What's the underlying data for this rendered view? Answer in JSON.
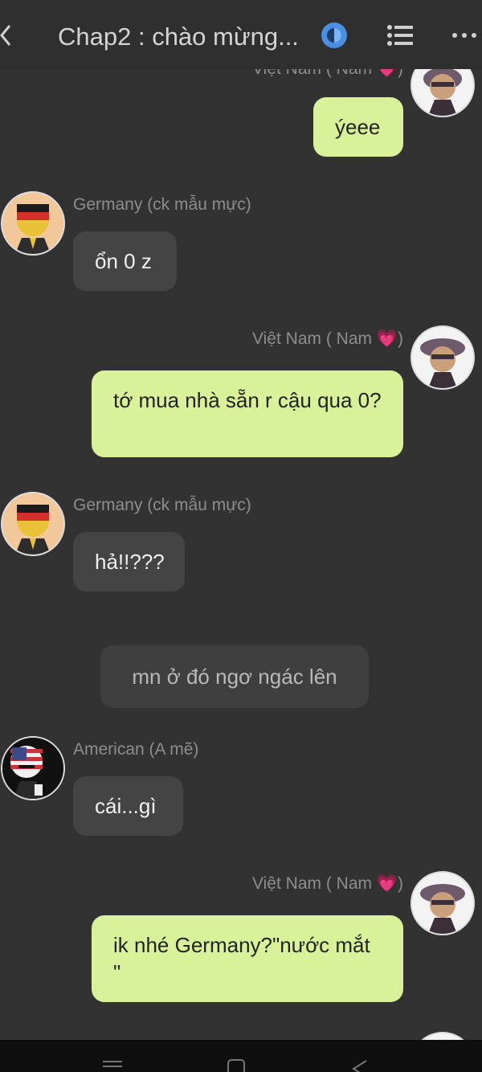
{
  "header": {
    "title": "Chap2 : chào mừng...",
    "icons": [
      "back-icon",
      "clock-icon",
      "list-icon",
      "more-icon"
    ],
    "accent": "#4a90e2"
  },
  "messages": [
    {
      "side": "right",
      "sender": "Việt Nam ( Nam 💗)",
      "text": "ýeee"
    },
    {
      "side": "left",
      "sender": "Germany (ck mẫu mực)",
      "text": "ổn 0 z"
    },
    {
      "side": "right",
      "sender": "Việt Nam ( Nam ",
      "sender_heart": "💗",
      "sender_end": ")",
      "text": "tớ mua nhà sẵn r cậu qua 0?"
    },
    {
      "side": "left",
      "sender": "Germany (ck mẫu mực)",
      "text": "hả!!???"
    },
    {
      "side": "narration",
      "text": "mn ở đó ngơ ngác lên"
    },
    {
      "side": "left",
      "sender": "American (A mẽ)",
      "text": "cái...gì"
    },
    {
      "side": "right",
      "sender": "Việt Nam ( Nam ",
      "sender_heart": "💗",
      "sender_end": ")",
      "text": "ik nhé Germany?\"nước mắt \""
    }
  ],
  "colors": {
    "background": "#323232",
    "my_bubble": "#d9f29a",
    "other_bubble": "#444444",
    "narration_bubble": "#3f3f3f"
  }
}
